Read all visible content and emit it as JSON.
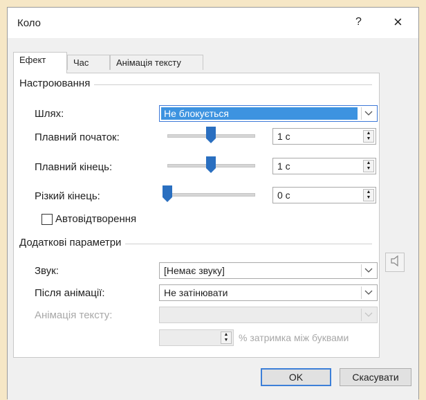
{
  "window": {
    "title": "Коло",
    "help_label": "?",
    "close_label": "×"
  },
  "tabs": [
    {
      "label": "Ефект",
      "active": true
    },
    {
      "label": "Час",
      "active": false
    },
    {
      "label": "Анімація тексту",
      "active": false
    }
  ],
  "settings": {
    "heading": "Настроювання",
    "path": {
      "label": "Шлях:",
      "value": "Не блокується"
    },
    "smooth_start": {
      "label": "Плавний початок:",
      "value": "1 с",
      "level": 0.5
    },
    "smooth_end": {
      "label": "Плавний кінець:",
      "value": "1 с",
      "level": 0.5
    },
    "bounce_end": {
      "label": "Різкий кінець:",
      "value": "0 с",
      "level": 0.0
    },
    "autoreverse": {
      "label": "Автовідтворення",
      "checked": false
    }
  },
  "extra": {
    "heading": "Додаткові параметри",
    "sound": {
      "label": "Звук:",
      "value": "[Немає звуку]"
    },
    "after_animation": {
      "label": "Після анімації:",
      "value": "Не затінювати"
    },
    "animate_text": {
      "label": "Анімація тексту:",
      "value": ""
    },
    "delay": {
      "value": "",
      "suffix": "% затримка між буквами"
    }
  },
  "buttons": {
    "ok": "OK",
    "cancel": "Скасувати"
  },
  "colors": {
    "accent": "#3d93e0",
    "slider_thumb": "#2a6fc0",
    "background": "#f6e7c6"
  }
}
